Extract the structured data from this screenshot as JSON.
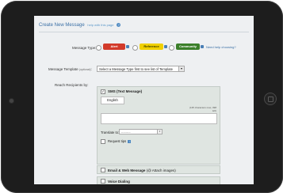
{
  "header": {
    "title": "Create New Message",
    "help_text": "help with this page",
    "help_icon": "question-icon"
  },
  "message_type": {
    "label": "Message Type:",
    "options": [
      {
        "label": "Alert",
        "color": "#d23a2a"
      },
      {
        "label": "Reference",
        "color": "#f0d000"
      },
      {
        "label": "Community",
        "color": "#3b7f2a"
      }
    ],
    "help_link": "Need help choosing?"
  },
  "template": {
    "label": "Message Template",
    "optional_note": "(optional)",
    "select_value": "Select a Message Type first to see list of Template"
  },
  "recipients": {
    "label": "Reach Recipients by:"
  },
  "sms": {
    "header": "SMS (Text Message)",
    "checked": true,
    "tab_label": "English",
    "chars_line1": "(135 characters max, 098",
    "chars_line2": "left)",
    "translate_label": "Translate to:",
    "translate_value": "----------",
    "request_tips_label": "Request tips"
  },
  "email": {
    "header": "Email & Web Message",
    "attach_note": "(@ Attach images)"
  },
  "voice": {
    "header": "Voice Dialing"
  }
}
